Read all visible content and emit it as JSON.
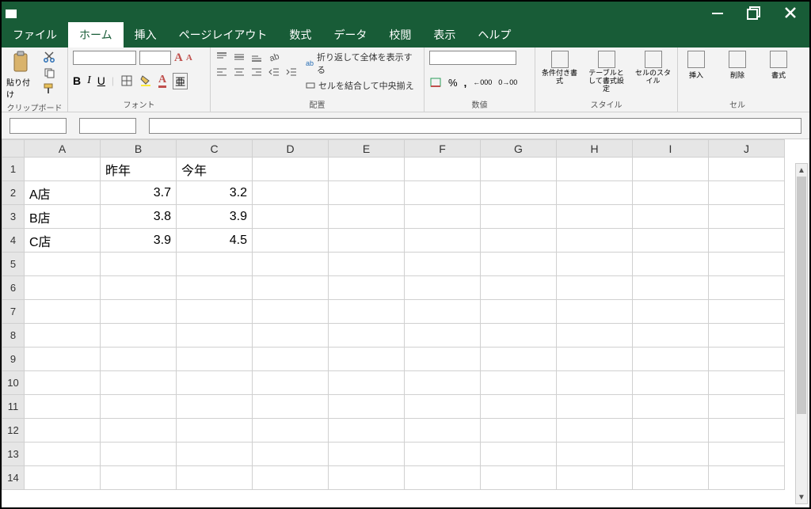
{
  "menu": {
    "file": "ファイル",
    "home": "ホーム",
    "insert": "挿入",
    "pageLayout": "ページレイアウト",
    "formulas": "数式",
    "data": "データ",
    "review": "校閲",
    "view": "表示",
    "help": "ヘルプ"
  },
  "ribbon": {
    "clipboard_label": "クリップボード",
    "paste": "貼り付け",
    "font_label": "フォント",
    "bold": "B",
    "italic": "I",
    "underline": "U",
    "bigA": "A",
    "smallA": "A",
    "fontA": "A",
    "ruby": "亜",
    "align_label": "配置",
    "wrap_text": "折り返して全体を表示する",
    "merge_center": "セルを結合して中央揃え",
    "ab_prefix": "ab",
    "number_label": "数値",
    "percent": "%",
    "comma": ",",
    "inc_dec": "00",
    "style_label": "スタイル",
    "cond_fmt": "条件付き書式",
    "table_fmt": "テーブルとして書式設定",
    "cell_style": "セルのスタイル",
    "cells_label": "セル",
    "insert_cell": "挿入",
    "delete_cell": "削除",
    "format_cell": "書式"
  },
  "formula_bar": {
    "name_box": "",
    "formula": ""
  },
  "grid": {
    "columns": [
      "A",
      "B",
      "C",
      "D",
      "E",
      "F",
      "G",
      "H",
      "I",
      "J"
    ],
    "row_count": 14,
    "cells": {
      "B1": {
        "v": "昨年",
        "align": "left"
      },
      "C1": {
        "v": "今年",
        "align": "left"
      },
      "A2": {
        "v": "A店",
        "align": "left"
      },
      "B2": {
        "v": "3.7",
        "align": "right"
      },
      "C2": {
        "v": "3.2",
        "align": "right"
      },
      "A3": {
        "v": "B店",
        "align": "left"
      },
      "B3": {
        "v": "3.8",
        "align": "right"
      },
      "C3": {
        "v": "3.9",
        "align": "right"
      },
      "A4": {
        "v": "C店",
        "align": "left"
      },
      "B4": {
        "v": "3.9",
        "align": "right"
      },
      "C4": {
        "v": "4.5",
        "align": "right"
      }
    }
  },
  "chart_data": {
    "type": "table",
    "columns": [
      "",
      "昨年",
      "今年"
    ],
    "rows": [
      [
        "A店",
        3.7,
        3.2
      ],
      [
        "B店",
        3.8,
        3.9
      ],
      [
        "C店",
        3.9,
        4.5
      ]
    ]
  }
}
